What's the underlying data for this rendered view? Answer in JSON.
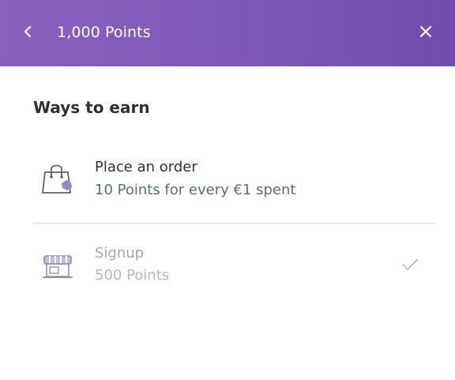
{
  "header": {
    "title": "1,000 Points",
    "back_icon": "chevron-left-icon",
    "close_icon": "close-icon",
    "gradient": [
      "#8a61c0",
      "#6f4eaf"
    ]
  },
  "section": {
    "title": "Ways to earn"
  },
  "earn_items": [
    {
      "icon": "shopping-bag-icon",
      "title": "Place an order",
      "subtitle": "10 Points for every €1 spent",
      "completed": false
    },
    {
      "icon": "storefront-icon",
      "title": "Signup",
      "subtitle": "500 Points",
      "completed": true,
      "status_icon": "checkmark-icon"
    }
  ],
  "colors": {
    "accent": "#7b58b8",
    "text_primary": "#2f2f36",
    "text_secondary": "#5a6e7a",
    "text_disabled": "#a4a7ad"
  }
}
